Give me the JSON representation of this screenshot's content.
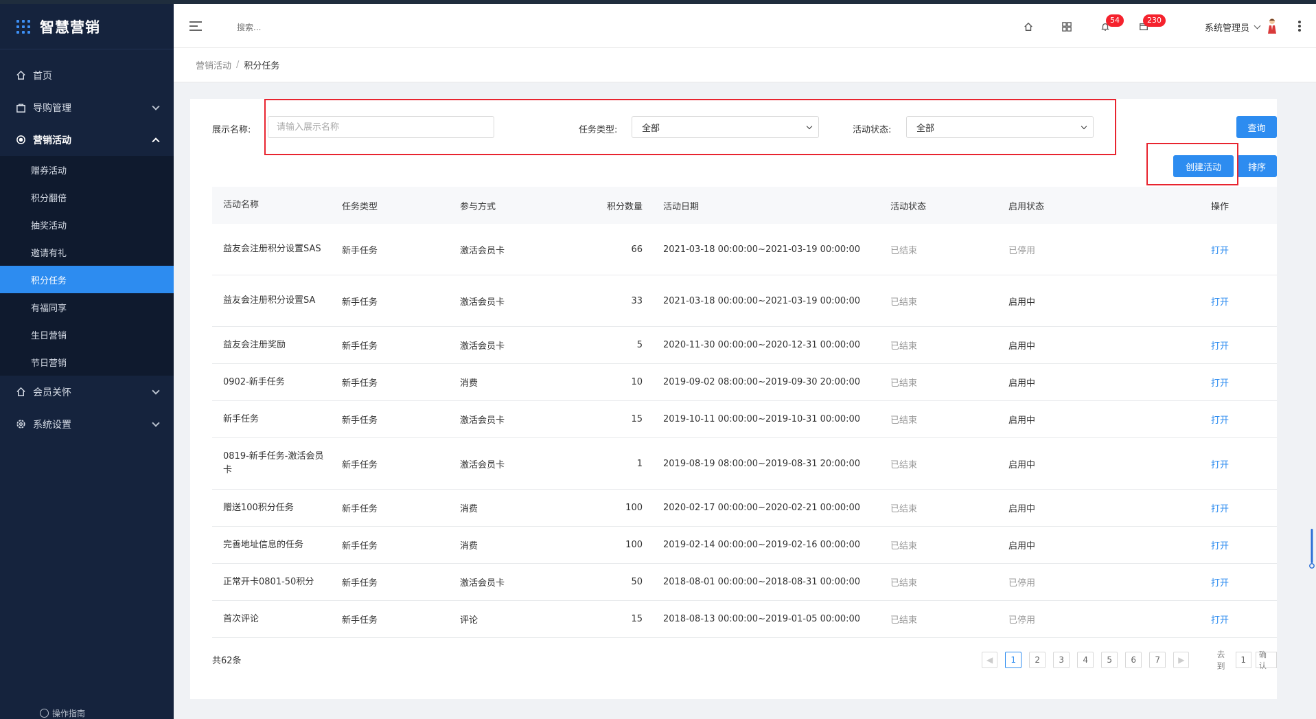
{
  "app": {
    "logo_text": "智慧营销"
  },
  "sidebar": {
    "items": [
      {
        "label": "首页"
      },
      {
        "label": "导购管理"
      },
      {
        "label": "营销活动"
      },
      {
        "label": "会员关怀"
      },
      {
        "label": "系统设置"
      }
    ],
    "submenu": [
      {
        "label": "赠券活动"
      },
      {
        "label": "积分翻倍"
      },
      {
        "label": "抽奖活动"
      },
      {
        "label": "邀请有礼"
      },
      {
        "label": "积分任务"
      },
      {
        "label": "有福同享"
      },
      {
        "label": "生日营销"
      },
      {
        "label": "节日营销"
      }
    ],
    "guide_label": "操作指南"
  },
  "header": {
    "search_placeholder": "搜索...",
    "bell_badge": "54",
    "message_badge": "230",
    "user_name": "系统管理员"
  },
  "breadcrumb": {
    "parent": "营销活动",
    "sep": "/",
    "current": "积分任务"
  },
  "filters": {
    "name_label": "展示名称:",
    "name_placeholder": "请输入展示名称",
    "type_label": "任务类型:",
    "type_value": "全部",
    "status_label": "活动状态:",
    "status_value": "全部"
  },
  "buttons": {
    "query": "查询",
    "create": "创建活动",
    "sort": "排序"
  },
  "table": {
    "headers": [
      "活动名称",
      "任务类型",
      "参与方式",
      "积分数量",
      "活动日期",
      "活动状态",
      "启用状态",
      "操作"
    ],
    "rows": [
      [
        "益友会注册积分设置SAS",
        "新手任务",
        "激活会员卡",
        "66",
        "2021-03-18  00:00:00~2021-03-19 00:00:00",
        "已结束",
        "已停用",
        "打开"
      ],
      [
        "益友会注册积分设置SA",
        "新手任务",
        "激活会员卡",
        "33",
        "2021-03-18  00:00:00~2021-03-19 00:00:00",
        "已结束",
        "启用中",
        "打开"
      ],
      [
        "益友会注册奖励",
        "新手任务",
        "激活会员卡",
        "5",
        "2020-11-30  00:00:00~2020-12-31 00:00:00",
        "已结束",
        "启用中",
        "打开"
      ],
      [
        "0902-新手任务",
        "新手任务",
        "消费",
        "10",
        "2019-09-02  08:00:00~2019-09-30 20:00:00",
        "已结束",
        "启用中",
        "打开"
      ],
      [
        "新手任务",
        "新手任务",
        "激活会员卡",
        "15",
        "2019-10-11  00:00:00~2019-10-31 00:00:00",
        "已结束",
        "启用中",
        "打开"
      ],
      [
        "0819-新手任务-激活会员卡",
        "新手任务",
        "激活会员卡",
        "1",
        "2019-08-19  08:00:00~2019-08-31 20:00:00",
        "已结束",
        "启用中",
        "打开"
      ],
      [
        "赠送100积分任务",
        "新手任务",
        "消费",
        "100",
        "2020-02-17  00:00:00~2020-02-21 00:00:00",
        "已结束",
        "启用中",
        "打开"
      ],
      [
        "完善地址信息的任务",
        "新手任务",
        "消费",
        "100",
        "2019-02-14  00:00:00~2019-02-16 00:00:00",
        "已结束",
        "启用中",
        "打开"
      ],
      [
        "正常开卡0801-50积分",
        "新手任务",
        "激活会员卡",
        "50",
        "2018-08-01  00:00:00~2018-08-31 00:00:00",
        "已结束",
        "已停用",
        "打开"
      ],
      [
        "首次评论",
        "新手任务",
        "评论",
        "15",
        "2018-08-13  00:00:00~2019-01-05 00:00:00",
        "已结束",
        "已停用",
        "打开"
      ]
    ]
  },
  "pagination": {
    "total": "共62条",
    "pages": [
      "1",
      "2",
      "3",
      "4",
      "5",
      "6",
      "7"
    ],
    "current": "1",
    "goto_label": "去到",
    "goto_value": "1",
    "confirm": "确认"
  },
  "colors": {
    "accent": "#2d8cf0",
    "sidebar_bg": "#15233d",
    "highlight": "#e8242f"
  }
}
